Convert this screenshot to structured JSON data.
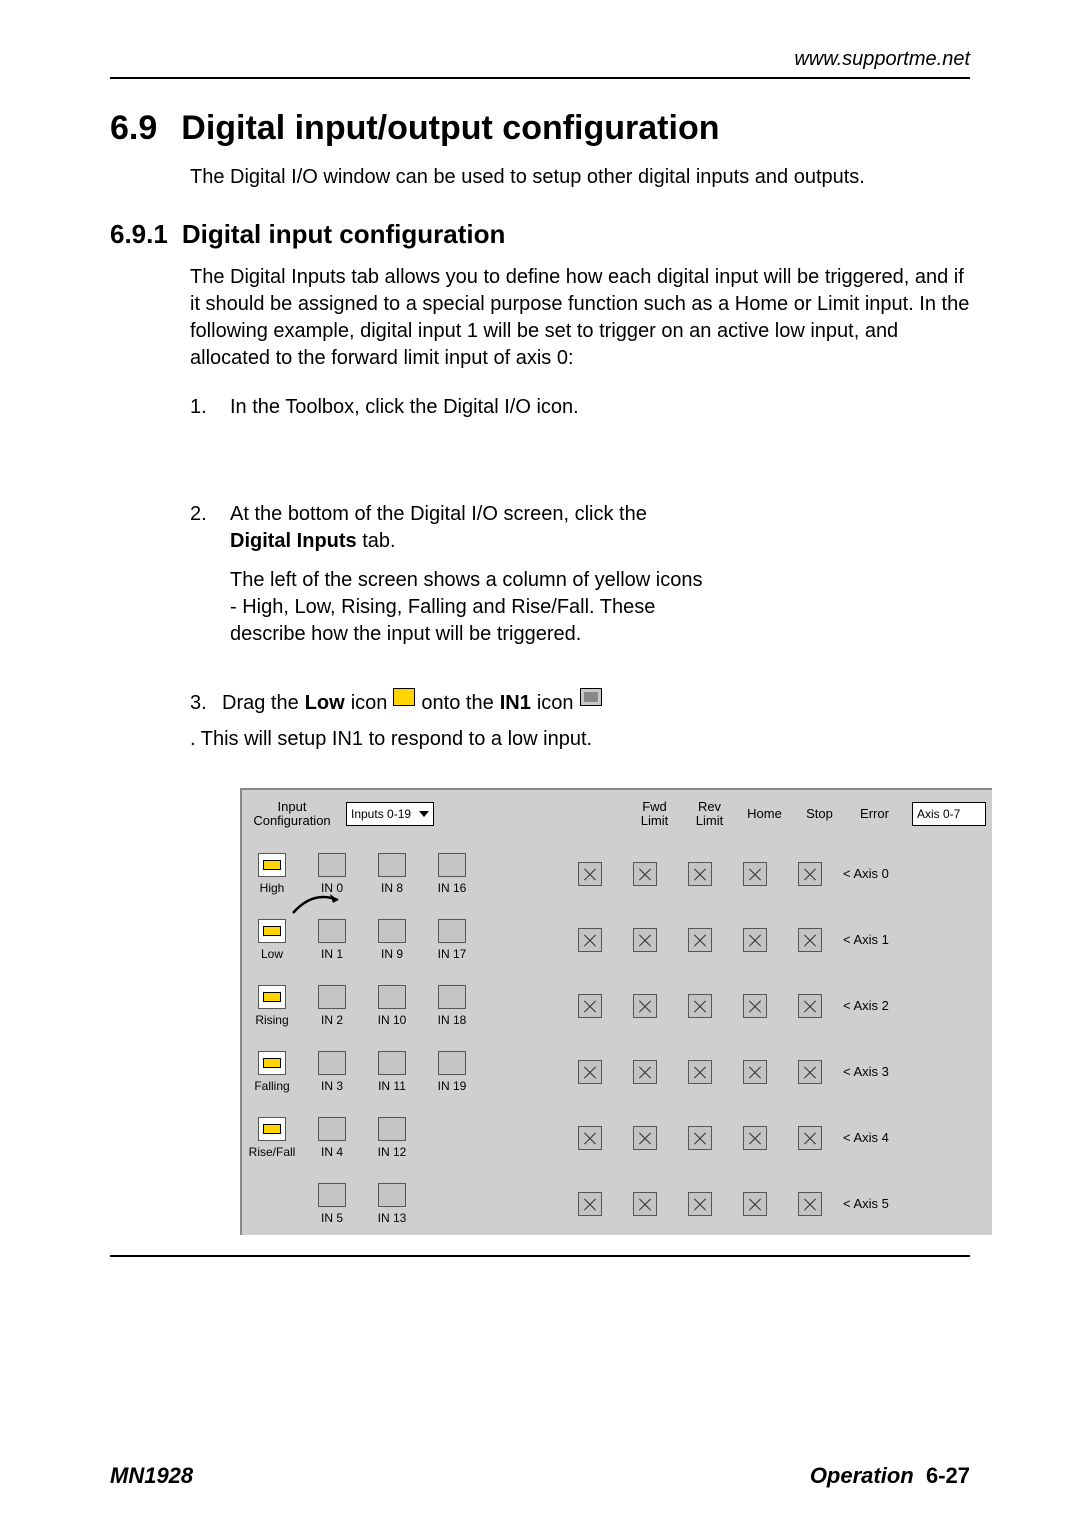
{
  "header_url": "www.supportme.net",
  "section": {
    "num": "6.9",
    "title": "Digital input/output configuration"
  },
  "intro": "The Digital I/O window can be used to setup other digital inputs and outputs.",
  "subsection": {
    "num": "6.9.1",
    "title": "Digital input configuration"
  },
  "sub_para": "The Digital Inputs tab allows you to define how each digital input will be triggered, and if it should be assigned to a special purpose function such as a Home or Limit input.  In the following example, digital input 1 will be set to trigger on an active low input, and allocated to the forward limit input of axis 0:",
  "step1": {
    "num": "1.",
    "text": "In the Toolbox, click the Digital I/O icon."
  },
  "step2": {
    "num": "2.",
    "line1a": "At the bottom of the Digital I/O screen, click the ",
    "bold": "Digital Inputs",
    "line1b": " tab.",
    "line2": "The left of the screen shows a column of yellow icons - High, Low, Rising, Falling and Rise/Fall. These describe how the input will be triggered."
  },
  "step3": {
    "num": "3.",
    "a": "Drag the ",
    "b": "Low",
    "c": " icon ",
    "d": " onto the ",
    "e": "IN1",
    "f": " icon ",
    "g": ". This will setup IN1 to respond to a low input."
  },
  "panel": {
    "input_config_label": "Input\nConfiguration",
    "inputs_sel": "Inputs 0-19",
    "cols": [
      "Fwd\nLimit",
      "Rev\nLimit",
      "Home",
      "Stop",
      "Error"
    ],
    "axis_sel": "Axis 0-7",
    "left_labels": [
      "High",
      "Low",
      "Rising",
      "Falling",
      "Rise/Fall",
      ""
    ],
    "in_grid": [
      [
        "IN 0",
        "IN 8",
        "IN 16"
      ],
      [
        "IN 1",
        "IN 9",
        "IN 17"
      ],
      [
        "IN 2",
        "IN 10",
        "IN 18"
      ],
      [
        "IN 3",
        "IN 11",
        "IN 19"
      ],
      [
        "IN 4",
        "IN 12",
        ""
      ],
      [
        "IN 5",
        "IN 13",
        ""
      ]
    ],
    "axis_rows": [
      "< Axis 0",
      "< Axis 1",
      "< Axis 2",
      "< Axis 3",
      "< Axis 4",
      "< Axis 5"
    ]
  },
  "footer": {
    "left": "MN1928",
    "right_label": "Operation",
    "right_page": "6-27"
  }
}
